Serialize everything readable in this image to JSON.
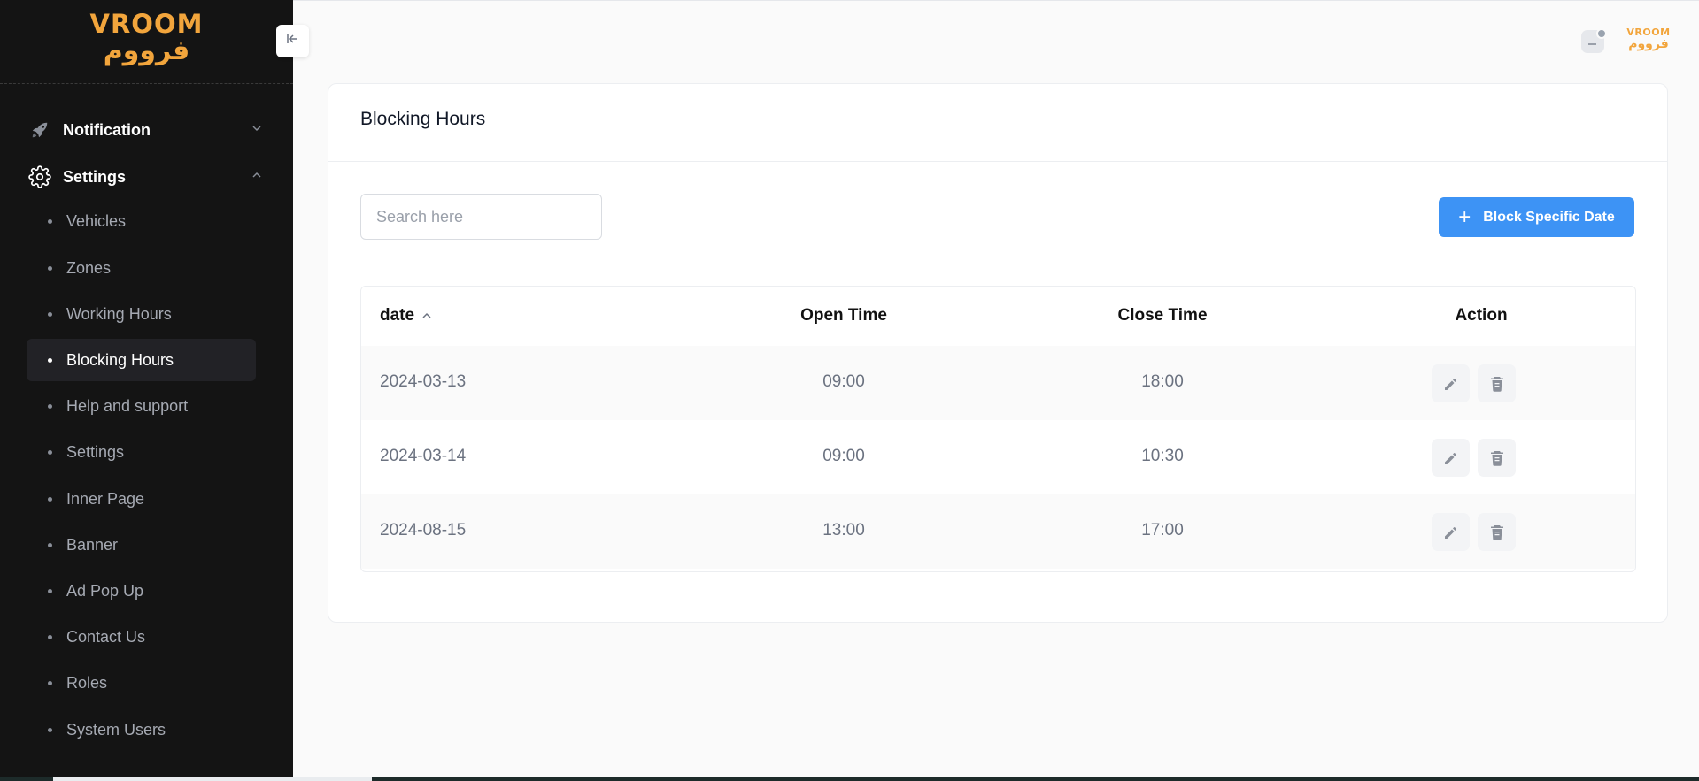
{
  "brand": {
    "logo_en": "VROOM",
    "logo_ar": "فرووم",
    "accent_color": "#f2a53c"
  },
  "sidebar": {
    "sections": [
      {
        "label": "Notification",
        "icon": "rocket-icon",
        "expanded": false
      },
      {
        "label": "Settings",
        "icon": "gear-icon",
        "expanded": true
      }
    ],
    "items": [
      {
        "label": "Vehicles"
      },
      {
        "label": "Zones"
      },
      {
        "label": "Working Hours"
      },
      {
        "label": "Blocking Hours",
        "active": true
      },
      {
        "label": "Help and support"
      },
      {
        "label": "Settings"
      },
      {
        "label": "Inner Page"
      },
      {
        "label": "Banner"
      },
      {
        "label": "Ad Pop Up"
      },
      {
        "label": "Contact Us"
      },
      {
        "label": "Roles"
      },
      {
        "label": "System Users"
      }
    ]
  },
  "header": {
    "collapse_icon": "arrow-left-icon",
    "mini_logo_en": "VROOM",
    "mini_logo_ar": "فرووم"
  },
  "main": {
    "title": "Blocking Hours",
    "search": {
      "placeholder": "Search here",
      "value": ""
    },
    "add_button": {
      "label": "Block Specific Date",
      "icon": "plus-icon",
      "color": "#3d93f5"
    },
    "table": {
      "columns": [
        "date",
        "Open Time",
        "Close Time",
        "Action"
      ],
      "sort": {
        "column": "date",
        "direction": "asc"
      },
      "rows": [
        {
          "date": "2024-03-13",
          "open": "09:00",
          "close": "18:00"
        },
        {
          "date": "2024-03-14",
          "open": "09:00",
          "close": "10:30"
        },
        {
          "date": "2024-08-15",
          "open": "13:00",
          "close": "17:00"
        }
      ],
      "actions": [
        "pencil-icon",
        "trash-icon"
      ]
    }
  }
}
